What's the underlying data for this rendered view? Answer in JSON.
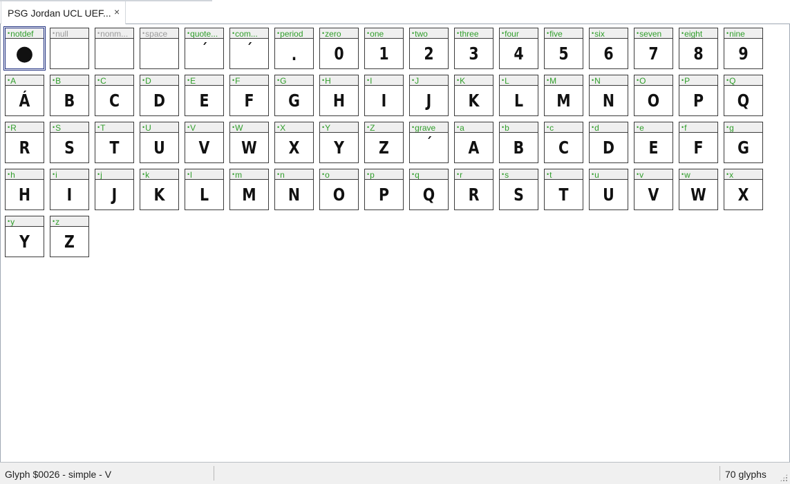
{
  "tab": {
    "title": "PSG Jordan UCL UEF...",
    "close_glyph": "×"
  },
  "glyphs": [
    {
      "name": "notdef",
      "char": "●",
      "kind": "bullet",
      "selected": true
    },
    {
      "name": "null",
      "char": "",
      "kind": "empty"
    },
    {
      "name": "nonm...",
      "char": "",
      "kind": "empty"
    },
    {
      "name": "space",
      "char": "",
      "kind": "empty"
    },
    {
      "name": "quote...",
      "char": "´",
      "kind": "accent"
    },
    {
      "name": "com...",
      "char": "´",
      "kind": "accent"
    },
    {
      "name": "period",
      "char": ".",
      "kind": "period"
    },
    {
      "name": "zero",
      "char": "0"
    },
    {
      "name": "one",
      "char": "1"
    },
    {
      "name": "two",
      "char": "2"
    },
    {
      "name": "three",
      "char": "3"
    },
    {
      "name": "four",
      "char": "4"
    },
    {
      "name": "five",
      "char": "5"
    },
    {
      "name": "six",
      "char": "6"
    },
    {
      "name": "seven",
      "char": "7"
    },
    {
      "name": "eight",
      "char": "8"
    },
    {
      "name": "nine",
      "char": "9"
    },
    {
      "name": "A",
      "char": "Á"
    },
    {
      "name": "B",
      "char": "B"
    },
    {
      "name": "C",
      "char": "C"
    },
    {
      "name": "D",
      "char": "D"
    },
    {
      "name": "E",
      "char": "E"
    },
    {
      "name": "F",
      "char": "F"
    },
    {
      "name": "G",
      "char": "G"
    },
    {
      "name": "H",
      "char": "H"
    },
    {
      "name": "I",
      "char": "I"
    },
    {
      "name": "J",
      "char": "J"
    },
    {
      "name": "K",
      "char": "K"
    },
    {
      "name": "L",
      "char": "L"
    },
    {
      "name": "M",
      "char": "M"
    },
    {
      "name": "N",
      "char": "N"
    },
    {
      "name": "O",
      "char": "O"
    },
    {
      "name": "P",
      "char": "P"
    },
    {
      "name": "Q",
      "char": "Q"
    },
    {
      "name": "R",
      "char": "R"
    },
    {
      "name": "S",
      "char": "S"
    },
    {
      "name": "T",
      "char": "T"
    },
    {
      "name": "U",
      "char": "U"
    },
    {
      "name": "V",
      "char": "V"
    },
    {
      "name": "W",
      "char": "W"
    },
    {
      "name": "X",
      "char": "X"
    },
    {
      "name": "Y",
      "char": "Y"
    },
    {
      "name": "Z",
      "char": "Z"
    },
    {
      "name": "grave",
      "char": "´",
      "kind": "accent"
    },
    {
      "name": "a",
      "char": "A"
    },
    {
      "name": "b",
      "char": "B"
    },
    {
      "name": "c",
      "char": "C"
    },
    {
      "name": "d",
      "char": "D"
    },
    {
      "name": "e",
      "char": "E"
    },
    {
      "name": "f",
      "char": "F"
    },
    {
      "name": "g",
      "char": "G"
    },
    {
      "name": "h",
      "char": "H"
    },
    {
      "name": "i",
      "char": "I"
    },
    {
      "name": "j",
      "char": "J"
    },
    {
      "name": "k",
      "char": "K"
    },
    {
      "name": "l",
      "char": "L"
    },
    {
      "name": "m",
      "char": "M"
    },
    {
      "name": "n",
      "char": "N"
    },
    {
      "name": "o",
      "char": "O"
    },
    {
      "name": "p",
      "char": "P"
    },
    {
      "name": "q",
      "char": "Q"
    },
    {
      "name": "r",
      "char": "R"
    },
    {
      "name": "s",
      "char": "S"
    },
    {
      "name": "t",
      "char": "T"
    },
    {
      "name": "u",
      "char": "U"
    },
    {
      "name": "v",
      "char": "V"
    },
    {
      "name": "w",
      "char": "W"
    },
    {
      "name": "x",
      "char": "X"
    },
    {
      "name": "y",
      "char": "Y"
    },
    {
      "name": "z",
      "char": "Z"
    }
  ],
  "status": {
    "left": "Glyph $0026 - simple - V",
    "right": "70 glyphs"
  },
  "colors": {
    "glyph_name_green": "#2f9d2a",
    "glyph_name_gray": "#9a9a9a",
    "selection_blue": "#20307f"
  }
}
